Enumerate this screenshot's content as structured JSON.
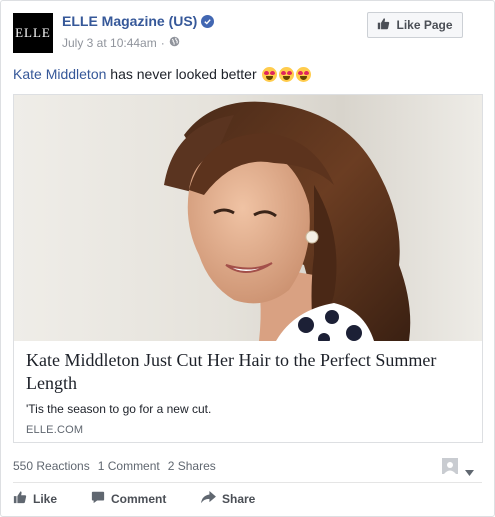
{
  "post": {
    "page_name": "ELLE Magazine (US)",
    "logo_text": "ELLE",
    "timestamp": "July 3 at 10:44am",
    "separator": "·",
    "like_page_label": "Like Page",
    "message_mention": "Kate Middleton",
    "message_text": " has never looked better",
    "message_emojis": [
      "heart-eyes-emoji",
      "heart-eyes-emoji",
      "heart-eyes-emoji"
    ]
  },
  "attachment": {
    "title": "Kate Middleton Just Cut Her Hair to the Perfect Summer Length",
    "description": "'Tis the season to go for a new cut.",
    "domain": "ELLE.COM"
  },
  "stats": {
    "reactions": "550 Reactions",
    "comments": "1 Comment",
    "shares": "2 Shares"
  },
  "actions": {
    "like_label": "Like",
    "comment_label": "Comment",
    "share_label": "Share"
  },
  "colors": {
    "link_blue": "#365899",
    "verified_blue": "#4267b2",
    "meta_gray": "#90949c",
    "action_gray": "#4b4f56"
  }
}
